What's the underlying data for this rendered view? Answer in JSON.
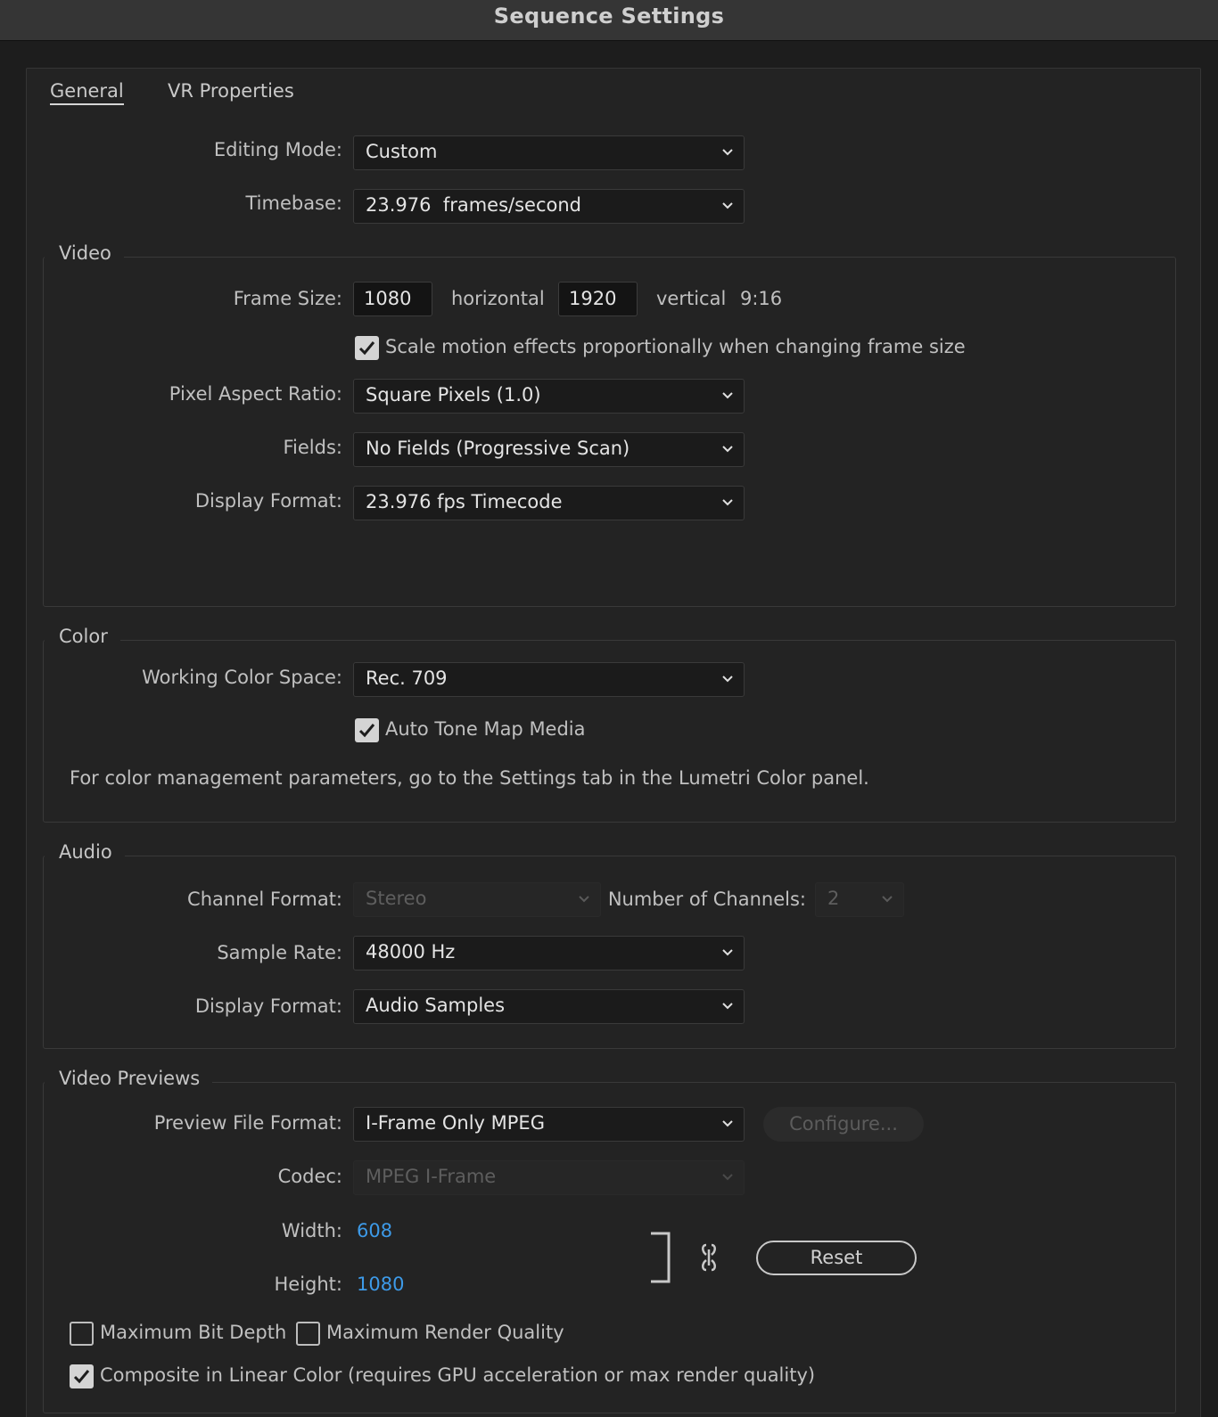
{
  "window": {
    "title": "Sequence Settings"
  },
  "tabs": [
    {
      "label": "General",
      "active": true
    },
    {
      "label": "VR Properties",
      "active": false
    }
  ],
  "general": {
    "editing_mode": {
      "label": "Editing Mode:",
      "value": "Custom"
    },
    "timebase": {
      "label": "Timebase:",
      "value": "23.976  frames/second"
    }
  },
  "video": {
    "legend": "Video",
    "frame_size": {
      "label": "Frame Size:",
      "horizontal_value": "1080",
      "horizontal_label": "horizontal",
      "vertical_value": "1920",
      "vertical_label": "vertical",
      "aspect": "9:16"
    },
    "scale_motion": {
      "label": "Scale motion effects proportionally when changing frame size",
      "checked": true
    },
    "pixel_aspect_ratio": {
      "label": "Pixel Aspect Ratio:",
      "value": "Square Pixels (1.0)"
    },
    "fields": {
      "label": "Fields:",
      "value": "No Fields (Progressive Scan)"
    },
    "display_format": {
      "label": "Display Format:",
      "value": "23.976 fps Timecode"
    }
  },
  "color": {
    "legend": "Color",
    "working_color_space": {
      "label": "Working Color Space:",
      "value": "Rec. 709"
    },
    "auto_tone_map": {
      "label": "Auto Tone Map Media",
      "checked": true
    },
    "note": "For color management parameters, go to the Settings tab in the Lumetri Color panel."
  },
  "audio": {
    "legend": "Audio",
    "channel_format": {
      "label": "Channel Format:",
      "value": "Stereo",
      "disabled": true
    },
    "number_of_channels": {
      "label": "Number of Channels:",
      "value": "2",
      "disabled": true
    },
    "sample_rate": {
      "label": "Sample Rate:",
      "value": "48000 Hz"
    },
    "display_format": {
      "label": "Display Format:",
      "value": "Audio Samples"
    }
  },
  "video_previews": {
    "legend": "Video Previews",
    "preview_file_format": {
      "label": "Preview File Format:",
      "value": "I-Frame Only MPEG"
    },
    "configure_button": "Configure...",
    "codec": {
      "label": "Codec:",
      "value": "MPEG I-Frame",
      "disabled": true
    },
    "width": {
      "label": "Width:",
      "value": "608"
    },
    "height": {
      "label": "Height:",
      "value": "1080"
    },
    "reset_button": "Reset",
    "max_bit_depth": {
      "label": "Maximum Bit Depth",
      "checked": false
    },
    "max_render_quality": {
      "label": "Maximum Render Quality",
      "checked": false
    },
    "composite_linear": {
      "label": "Composite in Linear Color (requires GPU acceleration or max render quality)",
      "checked": true
    }
  },
  "colors": {
    "background": "#1d1d1d",
    "panel": "#232323",
    "accent_link": "#3d9ae8",
    "titlebar": "#353535"
  }
}
